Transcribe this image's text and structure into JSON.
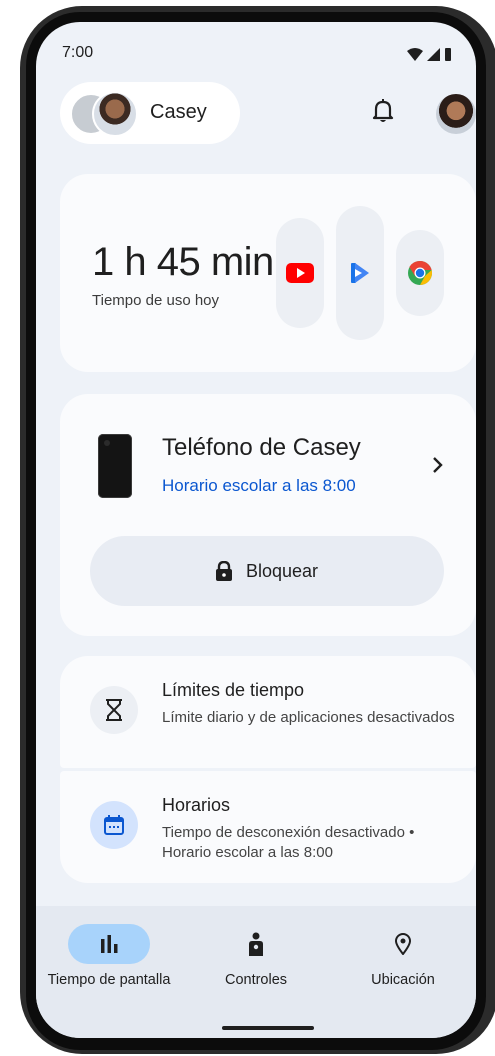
{
  "status_bar": {
    "time": "7:00"
  },
  "header": {
    "child_name": "Casey"
  },
  "usage": {
    "duration": "1 h 45 min",
    "label": "Tiempo de uso hoy"
  },
  "device": {
    "name": "Teléfono de Casey",
    "schedule": "Horario escolar a las 8:00",
    "lock_label": "Bloquear"
  },
  "settings": [
    {
      "title": "Límites de tiempo",
      "subtitle": "Límite diario y de aplicaciones desactivados"
    },
    {
      "title": "Horarios",
      "subtitle": "Tiempo de desconexión desactivado • Horario escolar a las 8:00"
    }
  ],
  "nav": {
    "items": [
      {
        "label": "Tiempo de pantalla"
      },
      {
        "label": "Controles"
      },
      {
        "label": "Ubicación"
      }
    ]
  },
  "colors": {
    "accent": "#0b57d0",
    "nav_active": "#a8d3fb",
    "calendar_bg": "#d3e3fd"
  }
}
